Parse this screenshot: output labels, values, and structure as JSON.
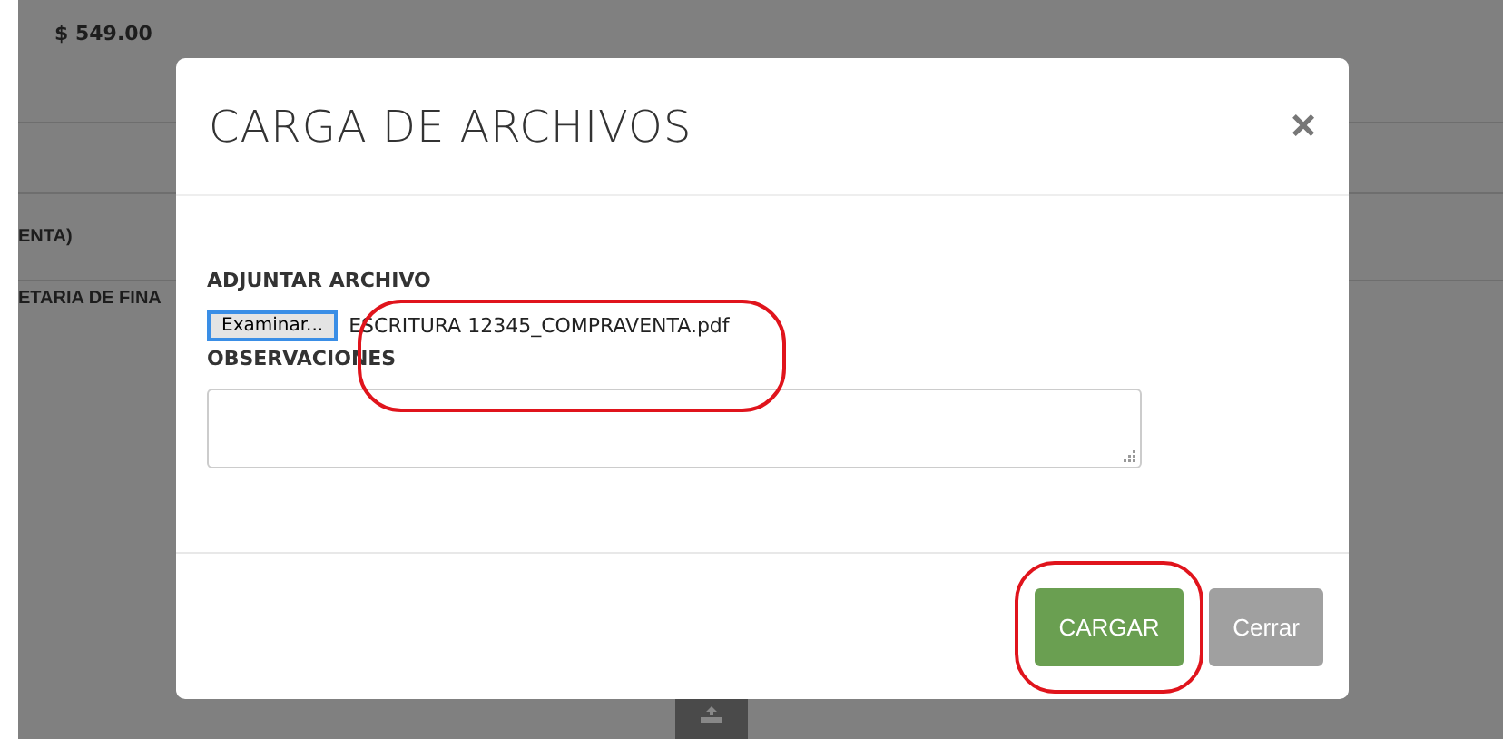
{
  "background": {
    "amount": "$ 549.00",
    "rows": [
      "ENTA)",
      "ETARIA DE FINA"
    ]
  },
  "modal": {
    "title": "CARGA DE ARCHIVOS",
    "close": "×",
    "file_label": "ADJUNTAR ARCHIVO",
    "browse_button": "Examinar...",
    "file_name": "ESCRITURA 12345_COMPRAVENTA.pdf",
    "notes_label": "OBSERVACIONES",
    "buttons": [
      {
        "label": "CARGAR",
        "kind": "primary",
        "highlighted": true
      },
      {
        "label": "Cerrar",
        "kind": "secondary",
        "highlighted": false
      }
    ]
  },
  "file_highlighted": true
}
